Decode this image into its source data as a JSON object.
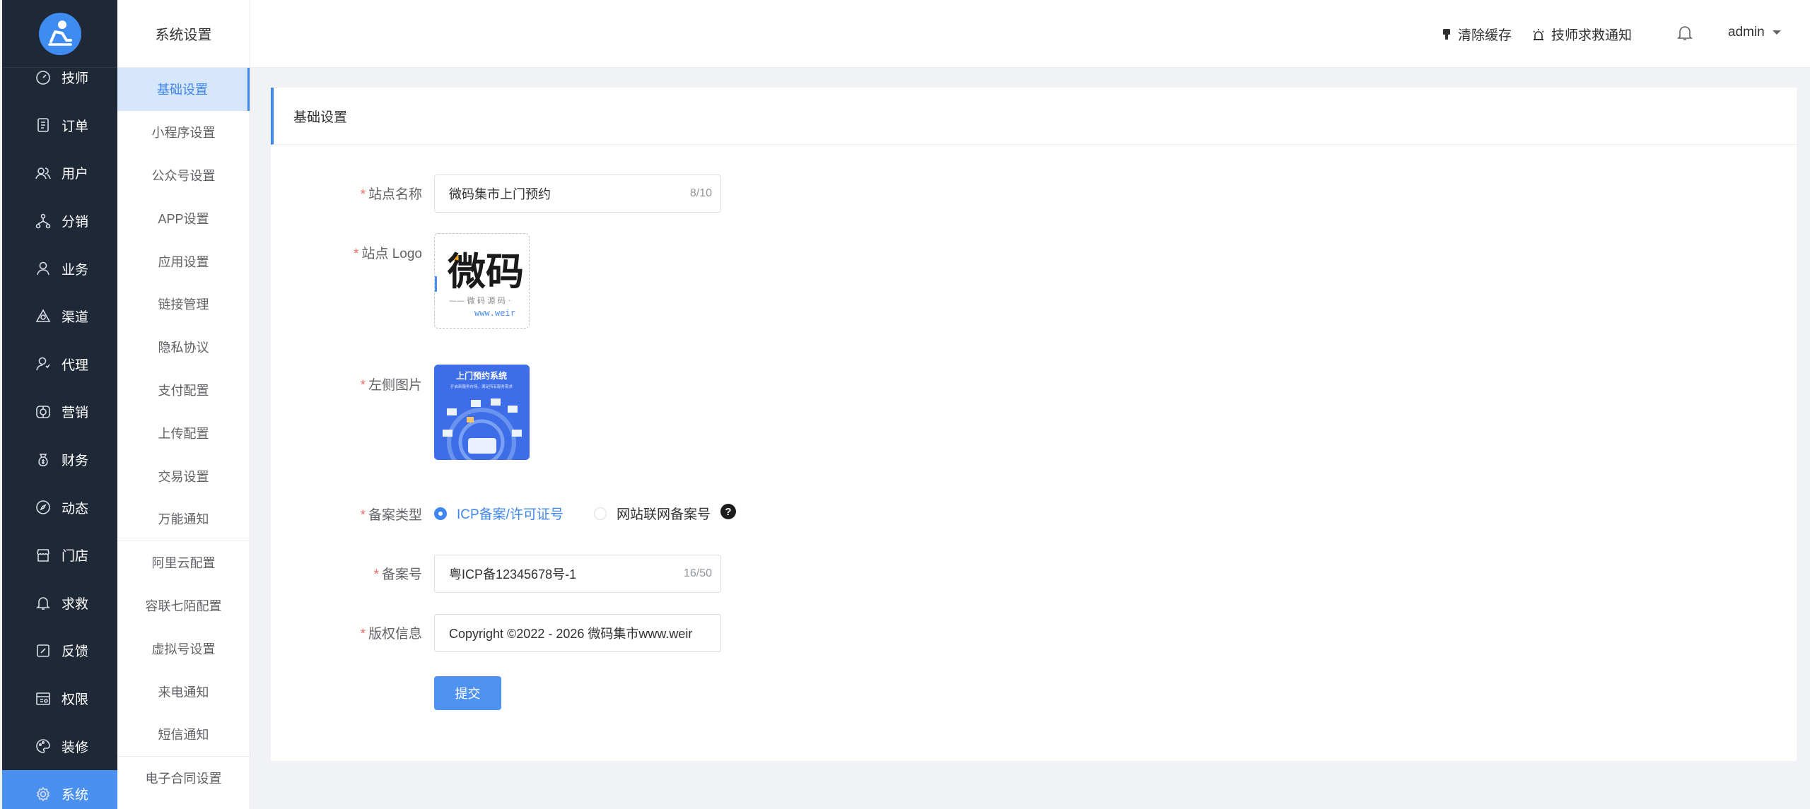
{
  "nav": {
    "items": [
      {
        "label": "技师",
        "icon": "dashboard-icon"
      },
      {
        "label": "订单",
        "icon": "order-icon"
      },
      {
        "label": "用户",
        "icon": "users-icon"
      },
      {
        "label": "分销",
        "icon": "distribution-icon"
      },
      {
        "label": "业务",
        "icon": "person-icon"
      },
      {
        "label": "渠道",
        "icon": "channel-icon"
      },
      {
        "label": "代理",
        "icon": "agent-icon"
      },
      {
        "label": "营销",
        "icon": "marketing-icon"
      },
      {
        "label": "财务",
        "icon": "money-bag-icon"
      },
      {
        "label": "动态",
        "icon": "compass-icon"
      },
      {
        "label": "门店",
        "icon": "store-icon"
      },
      {
        "label": "求救",
        "icon": "bell-icon"
      },
      {
        "label": "反馈",
        "icon": "feedback-icon"
      },
      {
        "label": "权限",
        "icon": "permission-icon"
      },
      {
        "label": "装修",
        "icon": "palette-icon"
      },
      {
        "label": "系统",
        "icon": "gear-icon"
      }
    ]
  },
  "sub": {
    "title": "系统设置",
    "groups": [
      [
        "基础设置",
        "小程序设置",
        "公众号设置",
        "APP设置",
        "应用设置",
        "链接管理",
        "隐私协议",
        "支付配置",
        "上传配置",
        "交易设置",
        "万能通知"
      ],
      [
        "阿里云配置",
        "容联七陌配置",
        "虚拟号设置",
        "来电通知",
        "短信通知"
      ],
      [
        "电子合同设置"
      ]
    ]
  },
  "header": {
    "clear_cache": "清除缓存",
    "rescue_notice": "技师求救通知",
    "user": "admin"
  },
  "card": {
    "title": "基础设置"
  },
  "form": {
    "site_name_label": "站点名称",
    "site_name_value": "微码集市上门预约",
    "site_name_count": "8/10",
    "logo_label": "站点 Logo",
    "logo_text": "微码",
    "logo_sub": "—— 微 码 源 码 ·",
    "logo_url": "www.weir",
    "left_image_label": "左侧图片",
    "left_image_title": "上门预约系统",
    "left_image_sub": "开启新服务市场，满足所有服务需求",
    "record_type_label": "备案类型",
    "record_type_options": [
      "ICP备案/许可证号",
      "网站联网备案号"
    ],
    "record_type_help": "?",
    "record_no_label": "备案号",
    "record_no_value": "粤ICP备12345678号-1",
    "record_no_count": "16/50",
    "copyright_label": "版权信息",
    "copyright_value": "Copyright ©2022 - 2026 微码集市www.weir",
    "submit_label": "提交"
  }
}
